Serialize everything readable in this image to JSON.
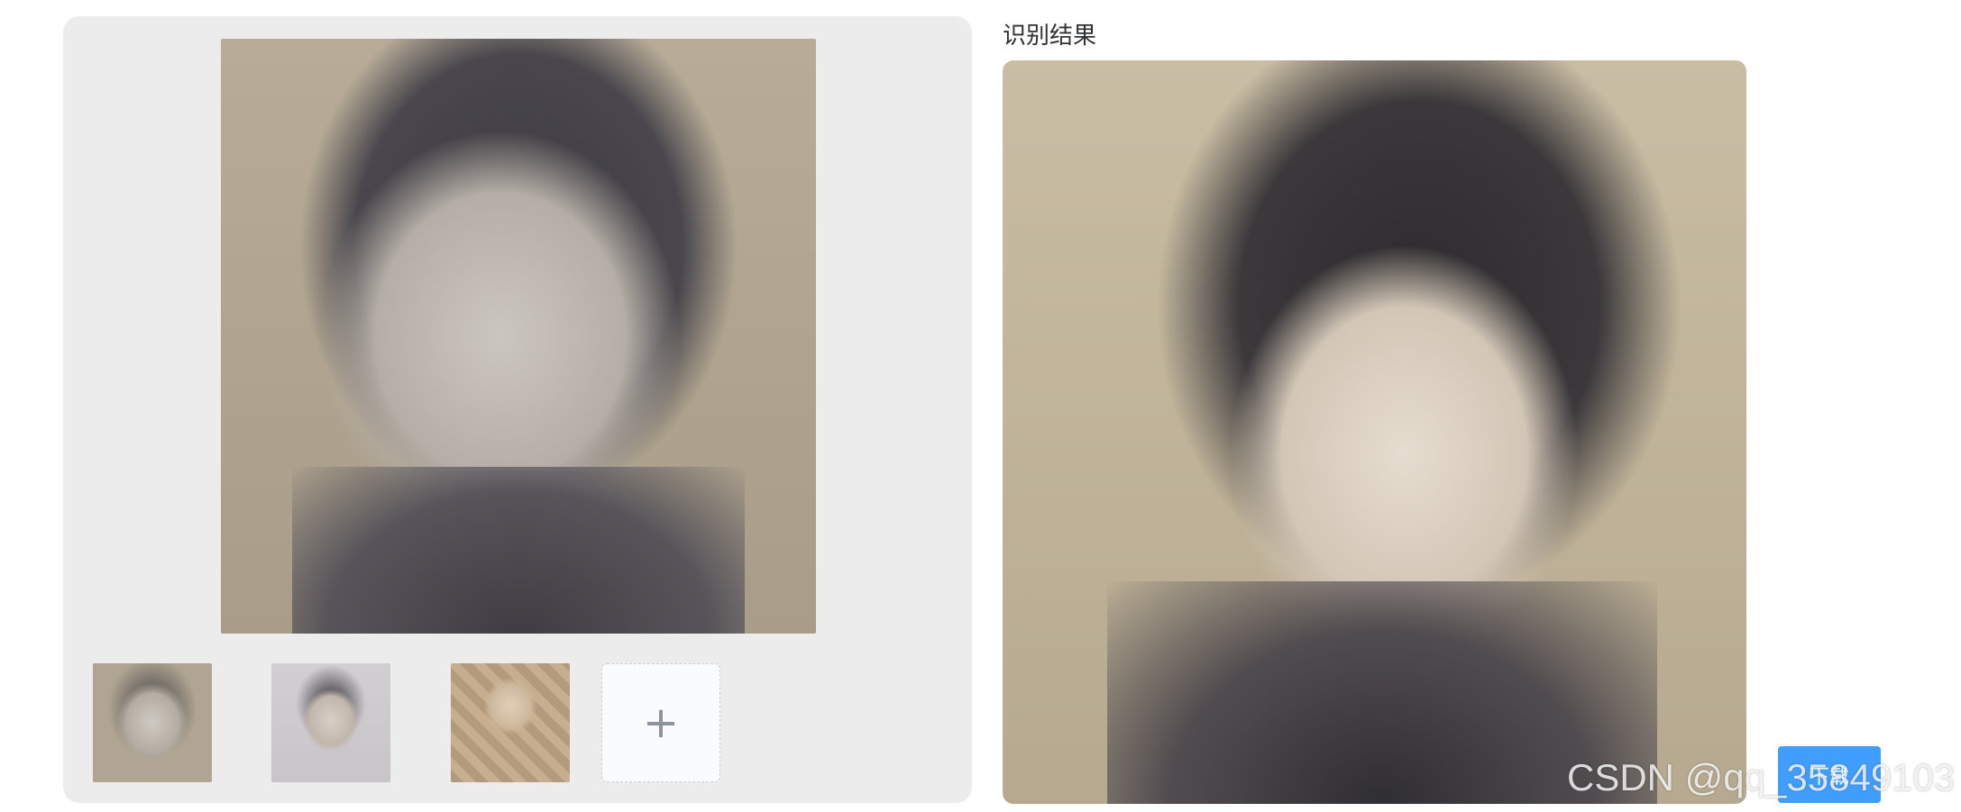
{
  "left_panel": {
    "main_photo_alt": "original photo",
    "thumbnails": [
      {
        "alt": "thumbnail 1"
      },
      {
        "alt": "thumbnail 2"
      },
      {
        "alt": "thumbnail 3"
      }
    ],
    "add_icon": "plus-icon",
    "add_glyph": "+"
  },
  "result": {
    "title": "识别结果",
    "photo_alt": "restored photo"
  },
  "download": {
    "label": "下载"
  },
  "watermark": {
    "text": "CSDN @qq_35849103"
  },
  "colors": {
    "panel_bg": "#ececed",
    "accent": "#409eff",
    "title_text": "#303133"
  }
}
